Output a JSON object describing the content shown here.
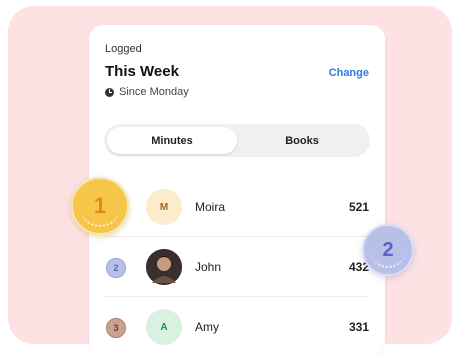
{
  "header": {
    "kicker": "Logged",
    "title": "This Week",
    "action_label": "Change",
    "since": "Since Monday"
  },
  "tabs": [
    {
      "label": "Minutes",
      "selected": true
    },
    {
      "label": "Books",
      "selected": false
    }
  ],
  "leaderboard": [
    {
      "rank": "1",
      "initials": "M",
      "name": "Moira",
      "score": "521",
      "avatar_color": "#fdeccc",
      "initials_color": "#a0671d"
    },
    {
      "rank": "2",
      "initials": "",
      "name": "John",
      "score": "432",
      "avatar_color": "#3a2f2c",
      "initials_color": "#ffffff"
    },
    {
      "rank": "3",
      "initials": "A",
      "name": "Amy",
      "score": "331",
      "avatar_color": "#d9f1e1",
      "initials_color": "#238a4b"
    }
  ],
  "medals": {
    "gold": "1",
    "silver": "2"
  },
  "colors": {
    "accent": "#2c7be5",
    "background_panel": "#fde1e3",
    "gold": "#f7c548",
    "silver": "#b8c0e8",
    "bronze": "#c9a18f"
  }
}
